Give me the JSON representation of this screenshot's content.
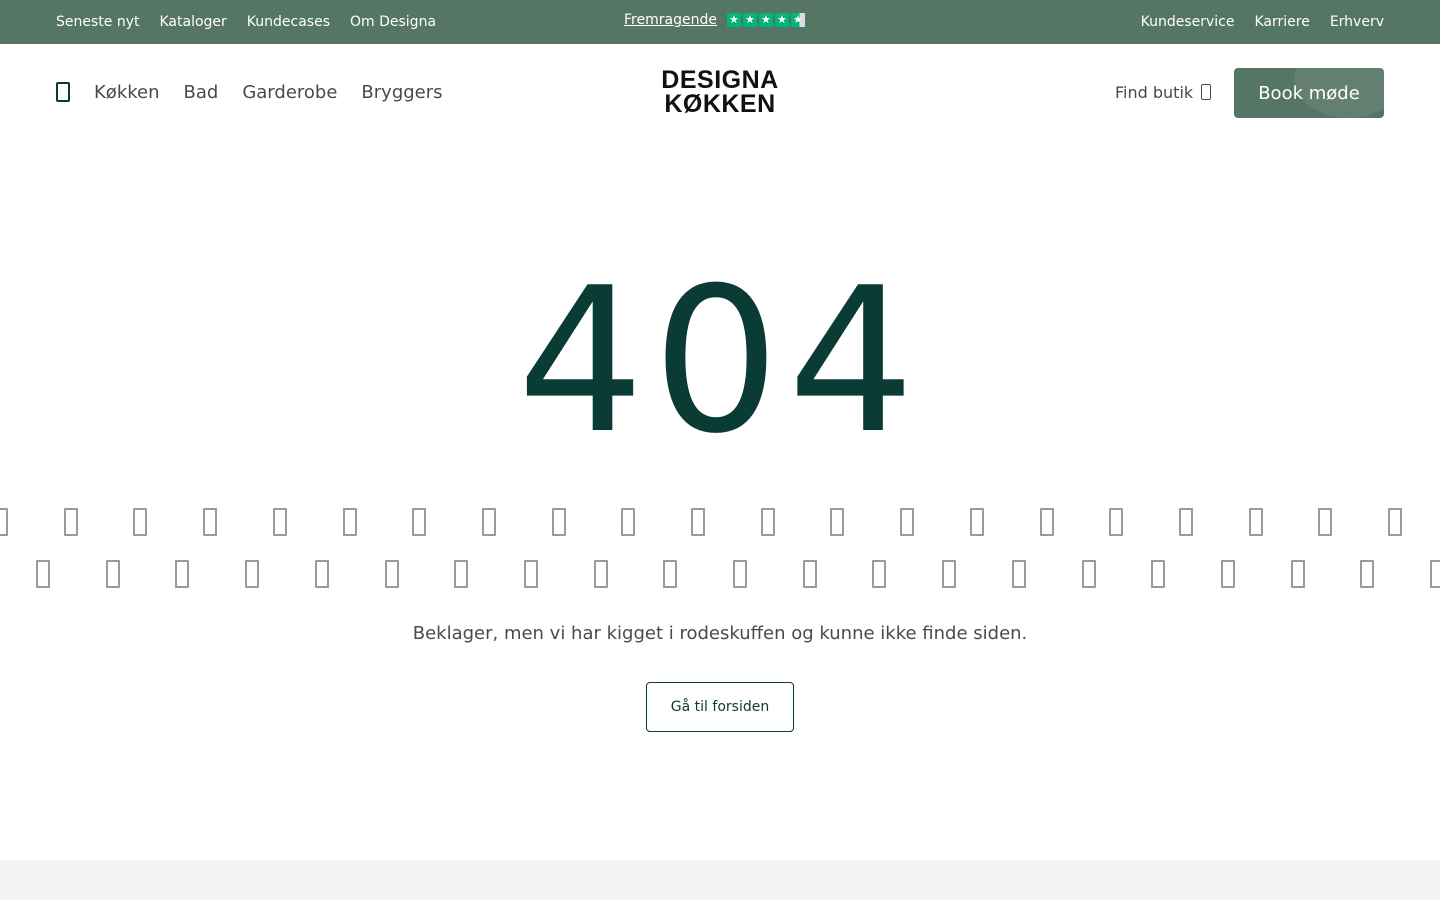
{
  "topbar": {
    "left_links": [
      "Seneste nyt",
      "Kataloger",
      "Kundecases",
      "Om Designa"
    ],
    "right_links": [
      "Kundeservice",
      "Karriere",
      "Erhverv"
    ],
    "trustpilot": {
      "label": "Fremragende",
      "rating_stars": 4.5,
      "star_color": "#00b67a"
    },
    "background_color": "#557565"
  },
  "header": {
    "menu_icon": "menu-icon",
    "nav": [
      "Køkken",
      "Bad",
      "Garderobe",
      "Bryggers"
    ],
    "logo": {
      "line1": "DESIGNA",
      "line2": "KØKKEN"
    },
    "find_store": {
      "label": "Find butik",
      "icon": "location-pin-icon"
    },
    "book_button": "Book møde",
    "accent_color": "#557565"
  },
  "main": {
    "error_code": "404",
    "error_color": "#0b3b35",
    "message": "Beklager, men vi har kigget i rodeskuffen og kunne ikke finde siden.",
    "home_button": "Gå til forsiden",
    "decorative_icon": "placeholder-glyph-icon"
  }
}
